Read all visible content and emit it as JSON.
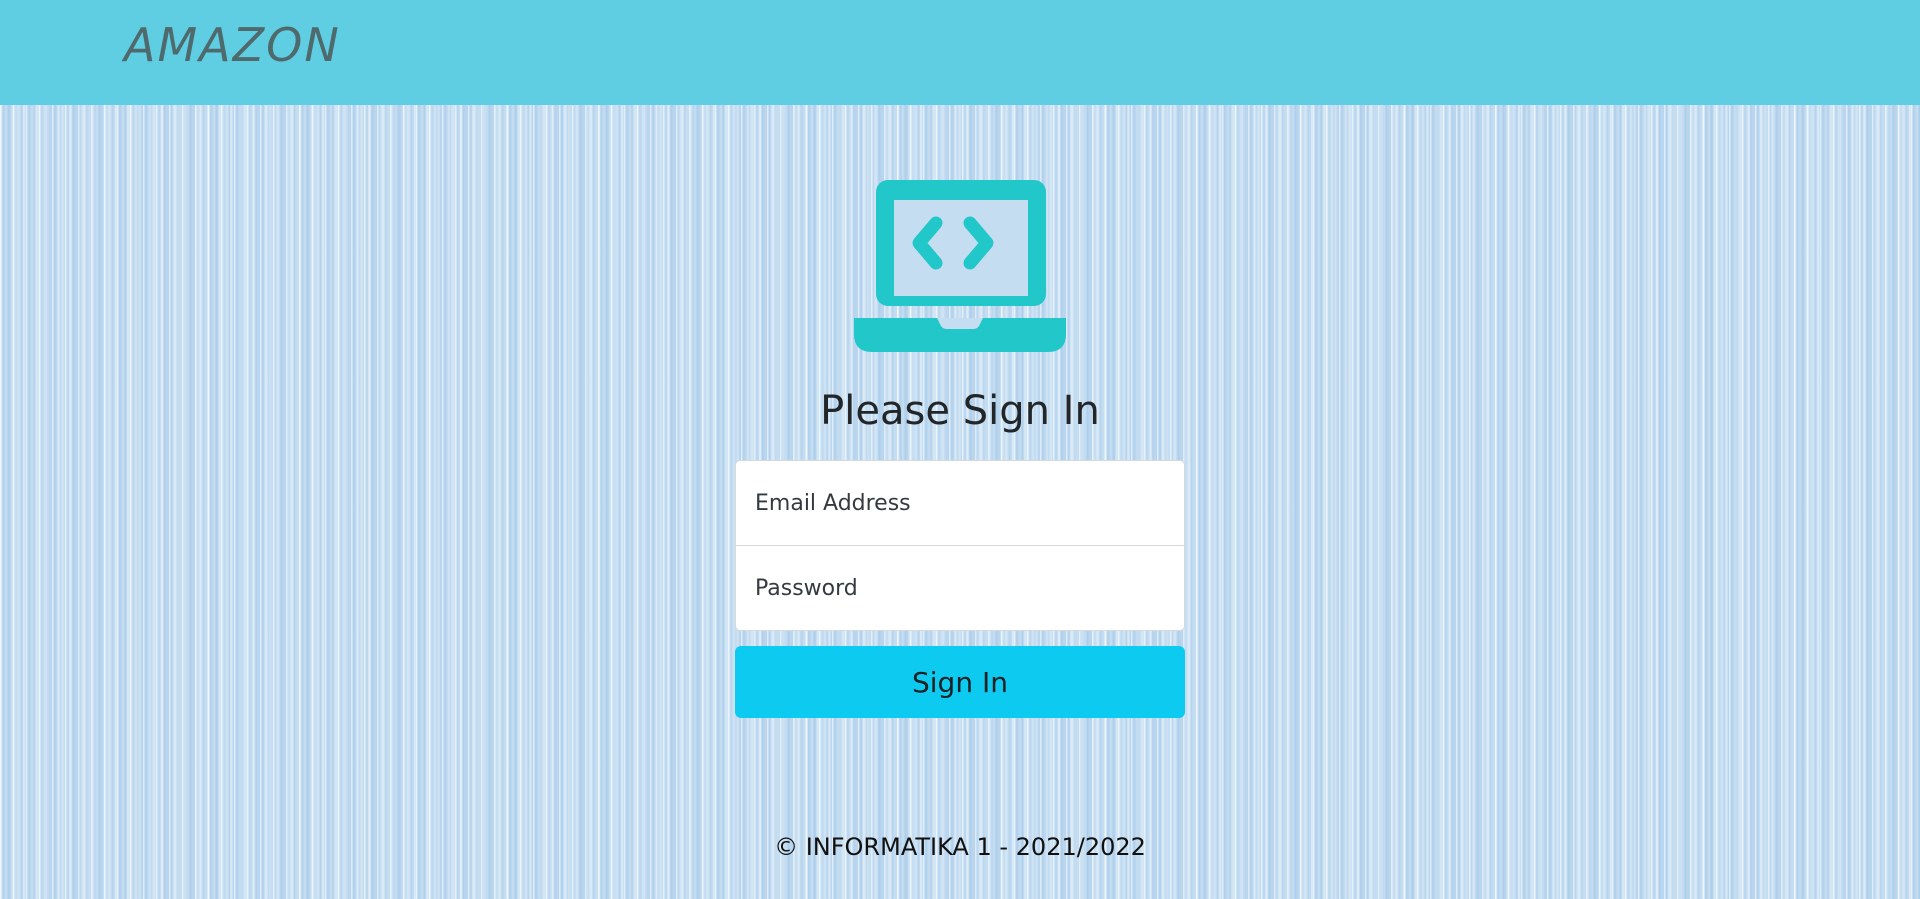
{
  "navbar": {
    "brand": "AMAZON",
    "background": "#5fcee2"
  },
  "logo": {
    "icon": "laptop-code-icon",
    "color": "#22c7c9"
  },
  "form": {
    "title": "Please Sign In",
    "email_placeholder": "Email Address",
    "password_placeholder": "Password",
    "submit_label": "Sign In",
    "submit_color": "#0dcaf0"
  },
  "footer": {
    "text": "© INFORMATIKA 1 - 2021/2022"
  }
}
